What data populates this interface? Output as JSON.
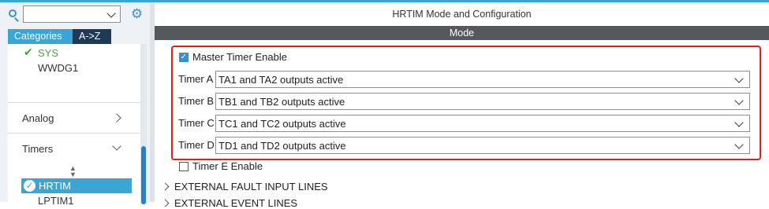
{
  "left_panel": {
    "search": {
      "value": "",
      "placeholder": ""
    },
    "tabs": [
      {
        "label": "Categories",
        "active": true
      },
      {
        "label": "A->Z",
        "active": false
      }
    ],
    "tree": {
      "sys_label": "SYS",
      "wwdg_label": "WWDG1",
      "categories": [
        {
          "label": "Analog",
          "expanded": false
        },
        {
          "label": "Timers",
          "expanded": true
        }
      ],
      "selected_item": "HRTIM",
      "next_item": "LPTIM1"
    }
  },
  "main": {
    "title": "HRTIM Mode and Configuration",
    "section": "Mode",
    "master_timer": {
      "label": "Master Timer Enable",
      "checked": true
    },
    "timers": [
      {
        "label": "Timer A",
        "value": "TA1 and TA2 outputs active"
      },
      {
        "label": "Timer B",
        "value": "TB1 and TB2 outputs active"
      },
      {
        "label": "Timer C",
        "value": "TC1 and TC2 outputs active"
      },
      {
        "label": "Timer D",
        "value": "TD1 and TD2 outputs active"
      }
    ],
    "timer_e": {
      "label": "Timer E Enable",
      "checked": false
    },
    "expanders": [
      {
        "label": "EXTERNAL FAULT INPUT LINES"
      },
      {
        "label": "EXTERNAL EVENT LINES"
      }
    ]
  },
  "colors": {
    "accent": "#3aa6d4",
    "highlight_border": "#e02020",
    "ok_green": "#47a341",
    "mode_bar": "#55595d"
  }
}
